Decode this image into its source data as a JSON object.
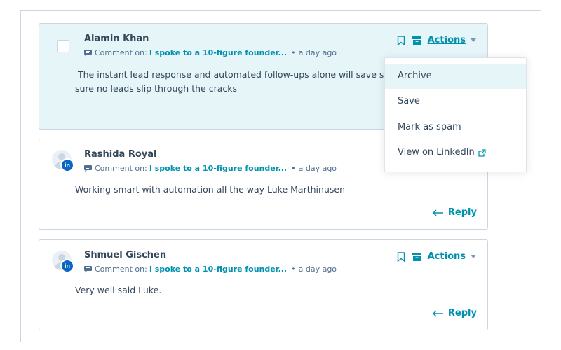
{
  "comments": [
    {
      "author": "Alamin Khan",
      "comment_on_prefix": "Comment on:",
      "post_title": "I spoke to a 10-figure founder...",
      "time": "a day ago",
      "body_line1": "The instant lead response and automated follow-ups alone will save so m",
      "body_line2": "sure no leads slip through the cracks",
      "actions_label": "Actions"
    },
    {
      "author": "Rashida Royal",
      "comment_on_prefix": "Comment on:",
      "post_title": "I spoke to a 10-figure founder...",
      "time": "a day ago",
      "body": "Working smart with automation all the way Luke Marthinusen",
      "reply_label": "Reply",
      "avatar_badge": "in"
    },
    {
      "author": "Shmuel Gischen",
      "comment_on_prefix": "Comment on:",
      "post_title": "I spoke to a 10-figure founder...",
      "time": "a day ago",
      "body": "Very well said Luke.",
      "actions_label": "Actions",
      "reply_label": "Reply",
      "avatar_badge": "in"
    }
  ],
  "actions_menu": {
    "items": [
      "Archive",
      "Save",
      "Mark as spam",
      "View on LinkedIn"
    ],
    "hovered": "Archive"
  },
  "colors": {
    "accent": "#0091ae",
    "selected_bg": "#e5f5f8",
    "text": "#33475b",
    "linkedin": "#0a66c2"
  },
  "icons": [
    "bookmark-icon",
    "archive-icon",
    "comment-icon",
    "chevron-down-icon",
    "reply-arrow-icon",
    "external-link-icon",
    "linkedin-icon"
  ]
}
